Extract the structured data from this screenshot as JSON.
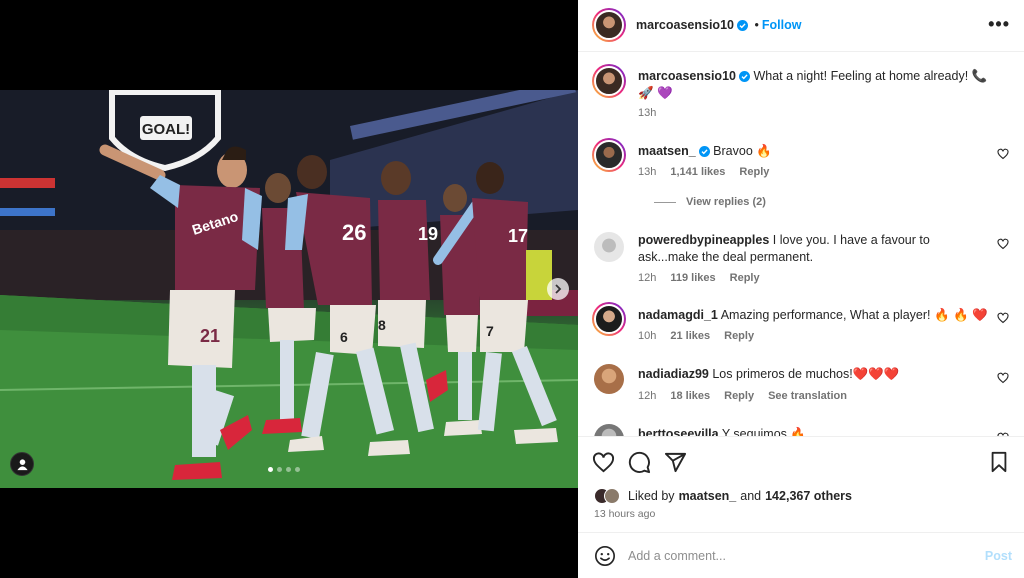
{
  "media": {
    "banner_text": "GOAL!",
    "sponsor_text": "Betano",
    "numbers": [
      "21",
      "26",
      "19",
      "8",
      "6",
      "17",
      "7"
    ],
    "carousel": {
      "count": 4,
      "active_index": 0
    }
  },
  "post": {
    "author": "marcoasensio10",
    "follow_label": "Follow",
    "caption": "What a night! Feeling at home already! 📞🚀 💜",
    "caption_time": "13h"
  },
  "comments": [
    {
      "user": "maatsen_",
      "verified": true,
      "text": "Bravoo 🔥",
      "time": "13h",
      "likes": "1,141 likes",
      "reply": "Reply",
      "view_replies": "View replies (2)"
    },
    {
      "user": "poweredbypineapples",
      "verified": false,
      "text": "I love you. I have a favour to ask...make the deal permanent.",
      "time": "12h",
      "likes": "119 likes",
      "reply": "Reply"
    },
    {
      "user": "nadamagdi_1",
      "verified": false,
      "text": "Amazing performance, What a player! 🔥 🔥 ❤️",
      "time": "10h",
      "likes": "21 likes",
      "reply": "Reply"
    },
    {
      "user": "nadiadiaz99",
      "verified": false,
      "text": "Los primeros de muchos!❤️❤️❤️",
      "time": "12h",
      "likes": "18 likes",
      "reply": "Reply",
      "translate": "See translation"
    },
    {
      "user": "berttoseevilla",
      "verified": false,
      "text": "Y seguimos 🔥",
      "time": "",
      "likes": "",
      "reply": ""
    }
  ],
  "likes_summary": {
    "prefix": "Liked by",
    "user": "maatsen_",
    "middle": "and",
    "others": "142,367 others"
  },
  "posted_ago": "13 hours ago",
  "composer": {
    "placeholder": "Add a comment...",
    "post_label": "Post"
  },
  "colors": {
    "accent": "#0095f6",
    "verified": "#0095f6",
    "muted": "#737373",
    "post_disabled": "#b2dffc",
    "villa_claret": "#7a2a45",
    "villa_blue": "#95bfe5"
  }
}
